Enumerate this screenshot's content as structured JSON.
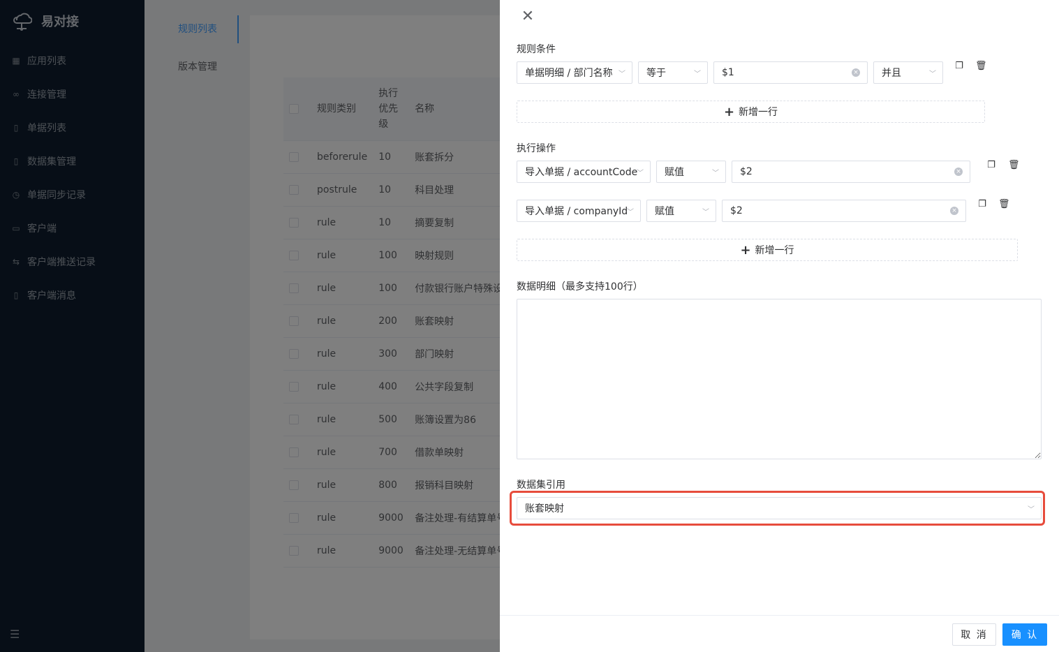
{
  "app": {
    "name": "易对接"
  },
  "sidebar": {
    "items": [
      {
        "label": "应用列表",
        "icon": "grid-icon"
      },
      {
        "label": "连接管理",
        "icon": "link-icon"
      },
      {
        "label": "单据列表",
        "icon": "document-icon"
      },
      {
        "label": "数据集管理",
        "icon": "document-icon"
      },
      {
        "label": "单据同步记录",
        "icon": "history-icon"
      },
      {
        "label": "客户端",
        "icon": "laptop-icon"
      },
      {
        "label": "客户端推送记录",
        "icon": "transfer-icon"
      },
      {
        "label": "客户端消息",
        "icon": "document-icon"
      }
    ]
  },
  "tabs": [
    {
      "label": "规则列表",
      "active": true
    },
    {
      "label": "版本管理",
      "active": false
    }
  ],
  "table": {
    "headers": {
      "type": "规则类别",
      "priority": "执行优先级",
      "name": "名称"
    },
    "rows": [
      {
        "type": "beforerule",
        "priority": "10",
        "name": "账套拆分"
      },
      {
        "type": "postrule",
        "priority": "10",
        "name": "科目处理"
      },
      {
        "type": "rule",
        "priority": "10",
        "name": "摘要复制"
      },
      {
        "type": "rule",
        "priority": "100",
        "name": "映射规则"
      },
      {
        "type": "rule",
        "priority": "100",
        "name": "付款银行账户特殊设定"
      },
      {
        "type": "rule",
        "priority": "200",
        "name": "账套映射"
      },
      {
        "type": "rule",
        "priority": "300",
        "name": "部门映射"
      },
      {
        "type": "rule",
        "priority": "400",
        "name": "公共字段复制"
      },
      {
        "type": "rule",
        "priority": "500",
        "name": "账簿设置为86"
      },
      {
        "type": "rule",
        "priority": "700",
        "name": "借款单映射"
      },
      {
        "type": "rule",
        "priority": "800",
        "name": "报销科目映射"
      },
      {
        "type": "rule",
        "priority": "9000",
        "name": "备注处理-有结算单号"
      },
      {
        "type": "rule",
        "priority": "9000",
        "name": "备注处理-无结算单号"
      }
    ]
  },
  "drawer": {
    "conditions": {
      "label": "规则条件",
      "row": {
        "field": "单据明细 / 部门名称",
        "operator": "等于",
        "value": "$1",
        "logic": "并且"
      },
      "add_label": "新增一行"
    },
    "actions": {
      "label": "执行操作",
      "rows": [
        {
          "field": "导入单据 / accountCode",
          "operator": "赋值",
          "value": "$2"
        },
        {
          "field": "导入单据 / companyId",
          "operator": "赋值",
          "value": "$2"
        }
      ],
      "add_label": "新增一行"
    },
    "detail": {
      "label": "数据明细（最多支持100行）",
      "value": ""
    },
    "dataset": {
      "label": "数据集引用",
      "value": "账套映射"
    },
    "footer": {
      "cancel": "取 消",
      "confirm": "确 认"
    }
  },
  "colors": {
    "primary": "#1890ff",
    "sidebar_bg": "#0e1c2e",
    "highlight": "#e74c3c"
  }
}
